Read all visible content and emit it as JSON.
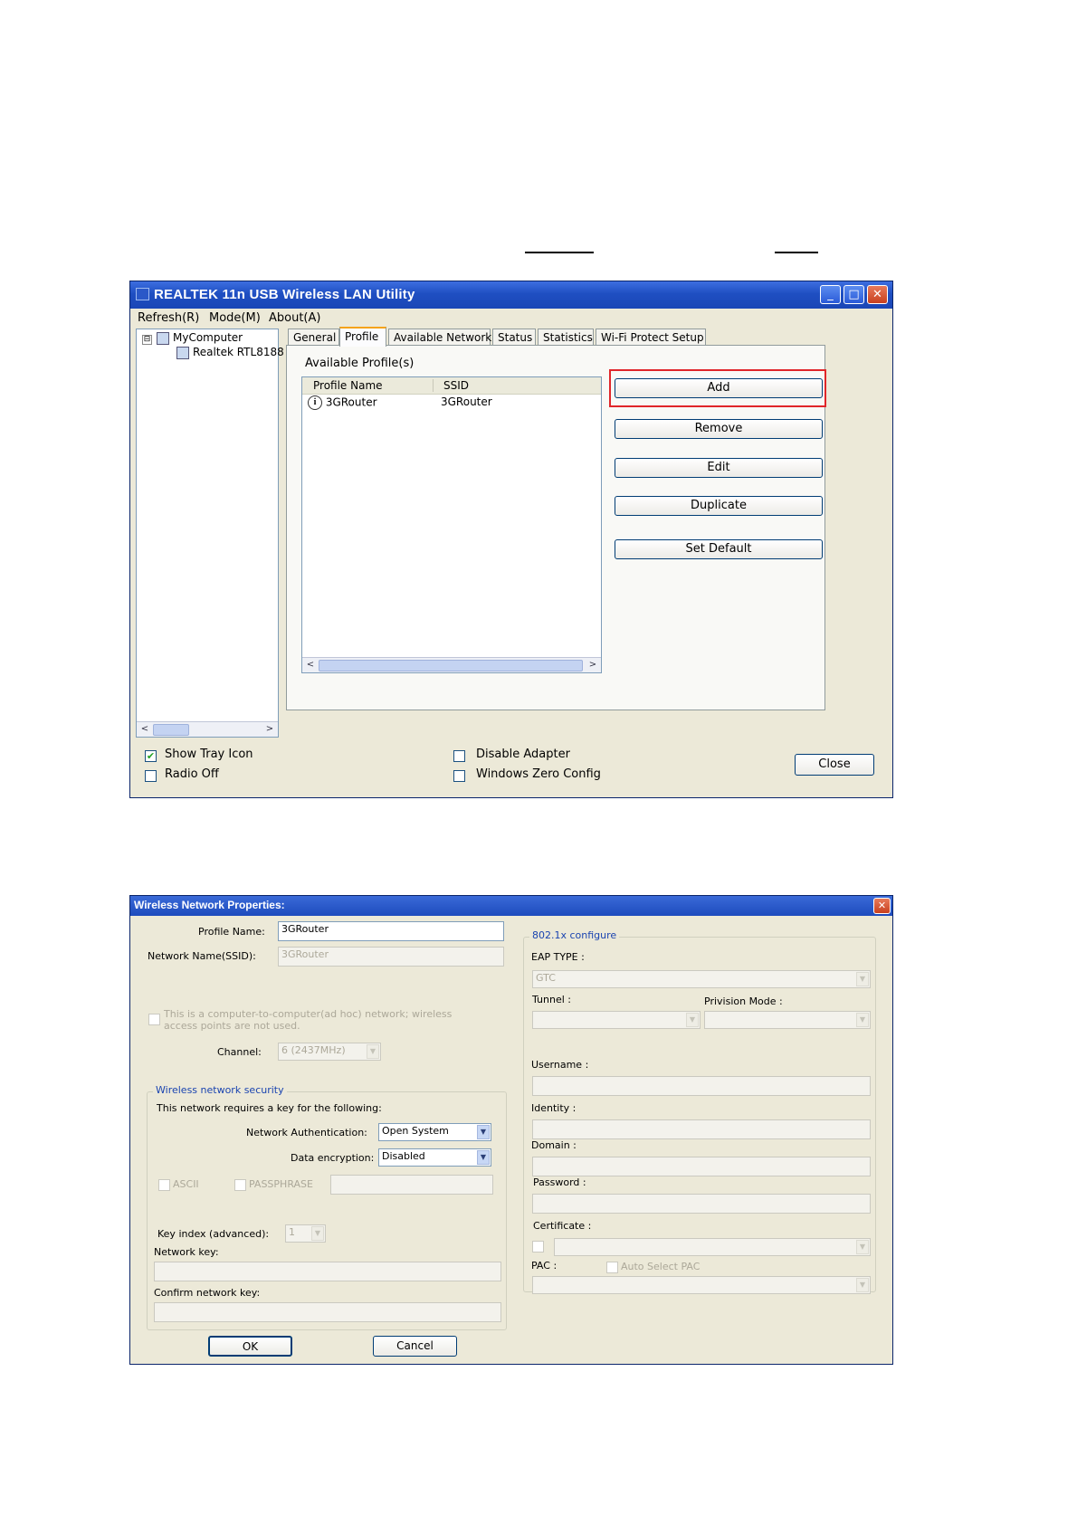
{
  "window1": {
    "title": "REALTEK 11n USB Wireless LAN Utility",
    "controls": {
      "minimize": "_",
      "maximize": "□",
      "close": "✕"
    },
    "menu": [
      "Refresh(R)",
      "Mode(M)",
      "About(A)"
    ],
    "tree": {
      "expander": "⊟",
      "root": "MyComputer",
      "child": "Realtek RTL8188"
    },
    "tabs": [
      "General",
      "Profile",
      "Available Network",
      "Status",
      "Statistics",
      "Wi-Fi Protect Setup"
    ],
    "active_tab": "Profile",
    "profile": {
      "section_label": "Available Profile(s)",
      "columns": [
        "Profile Name",
        "SSID"
      ],
      "rows": [
        {
          "name": "3GRouter",
          "ssid": "3GRouter",
          "icon": "info-icon"
        }
      ],
      "buttons": [
        "Add",
        "Remove",
        "Edit",
        "Duplicate",
        "Set Default"
      ],
      "highlighted_button": "Add",
      "highlight_color": "#e0262a"
    },
    "footer": {
      "show_tray_icon": {
        "label": "Show Tray Icon",
        "checked": true
      },
      "radio_off": {
        "label": "Radio Off",
        "checked": false
      },
      "disable_adapter": {
        "label": "Disable Adapter",
        "checked": false
      },
      "windows_zero_config": {
        "label": "Windows Zero Config",
        "checked": false
      },
      "close_button": "Close"
    },
    "scroll_arrows": {
      "left": "<",
      "right": ">"
    }
  },
  "window2": {
    "title": "Wireless Network Properties:",
    "close": "✕",
    "profile_name": {
      "label": "Profile Name:",
      "value": "3GRouter"
    },
    "ssid": {
      "label": "Network Name(SSID):",
      "value": "3GRouter"
    },
    "adhoc": {
      "line1": "This is a computer-to-computer(ad hoc) network; wireless",
      "line2": "access points are not used.",
      "checked": false
    },
    "channel": {
      "label": "Channel:",
      "value": "6  (2437MHz)"
    },
    "security": {
      "legend": "Wireless network security",
      "intro": "This network requires a key for the following:",
      "auth": {
        "label": "Network Authentication:",
        "value": "Open System"
      },
      "encryption": {
        "label": "Data encryption:",
        "value": "Disabled"
      },
      "ascii": "ASCII",
      "passphrase": "PASSPHRASE",
      "key_index": {
        "label": "Key index (advanced):",
        "value": "1"
      },
      "network_key": "Network key:",
      "confirm_key": "Confirm network key:"
    },
    "dot1x": {
      "legend": "802.1x configure",
      "eap_type": {
        "label": "EAP TYPE :",
        "value": "GTC"
      },
      "tunnel": "Tunnel :",
      "provision_mode": "Privision Mode :",
      "username": "Username :",
      "identity": "Identity :",
      "domain": "Domain :",
      "password": "Password :",
      "certificate": "Certificate :",
      "pac": "PAC :",
      "auto_select_pac": "Auto Select PAC"
    },
    "ok": "OK",
    "cancel": "Cancel",
    "dropdown_arrow": "▼"
  }
}
